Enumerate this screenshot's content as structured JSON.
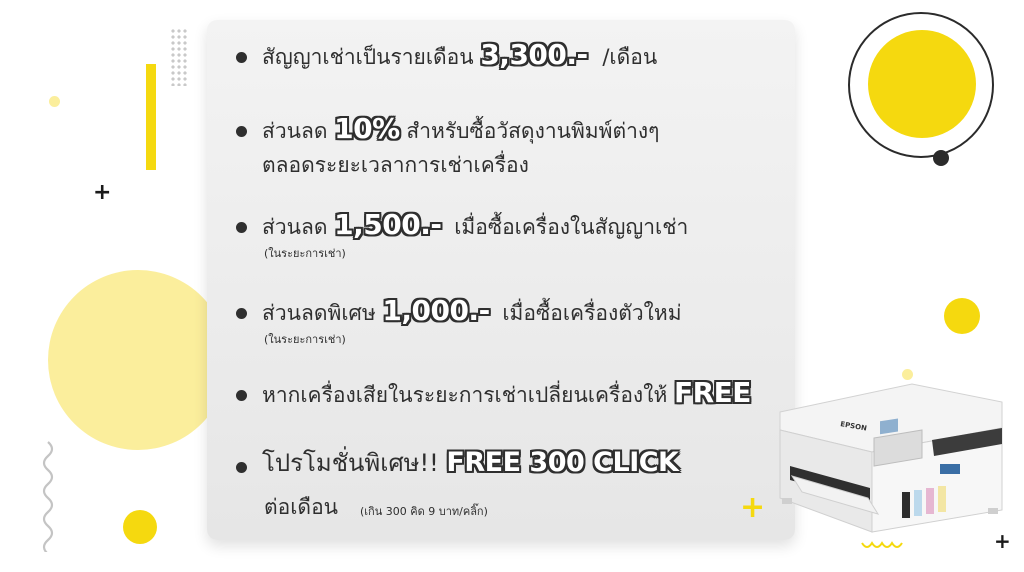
{
  "items": [
    {
      "text_before": "สัญญาเช่าเป็นรายเดือน",
      "highlight": "3,300.-",
      "text_after": "/เดือน"
    },
    {
      "text_before": "ส่วนลด",
      "highlight": "10%",
      "text_after": "สำหรับซื้อวัสดุงานพิมพ์ต่างๆ",
      "line2": "ตลอดระยะเวลาการเช่าเครื่อง"
    },
    {
      "text_before": "ส่วนลด",
      "highlight": "1,500.-",
      "text_after": "เมื่อซื้อเครื่องในสัญญาเช่า",
      "note": "(ในระยะการเช่า)"
    },
    {
      "text_before": "ส่วนลดพิเศษ",
      "highlight": "1,000.-",
      "text_after": "เมื่อซื้อเครื่องตัวใหม่",
      "note": "(ในระยะการเช่า)"
    },
    {
      "text_before": "หากเครื่องเสียในระยะการเช่าเปลี่ยนเครื่องให้",
      "highlight": "FREE"
    },
    {
      "text_before": "โปรโมชั่นพิเศษ!!",
      "highlight": "FREE 300 CLICK",
      "line2": "ต่อเดือน",
      "note": "(เกิน 300 คิด 9 บาท/คลิ๊ก)"
    }
  ],
  "printer": {
    "brand": "EPSON"
  },
  "colors": {
    "accent": "#f5d90f",
    "accent_light": "#fbee9c",
    "text": "#2f2f2f",
    "card": "#eeeeee"
  }
}
